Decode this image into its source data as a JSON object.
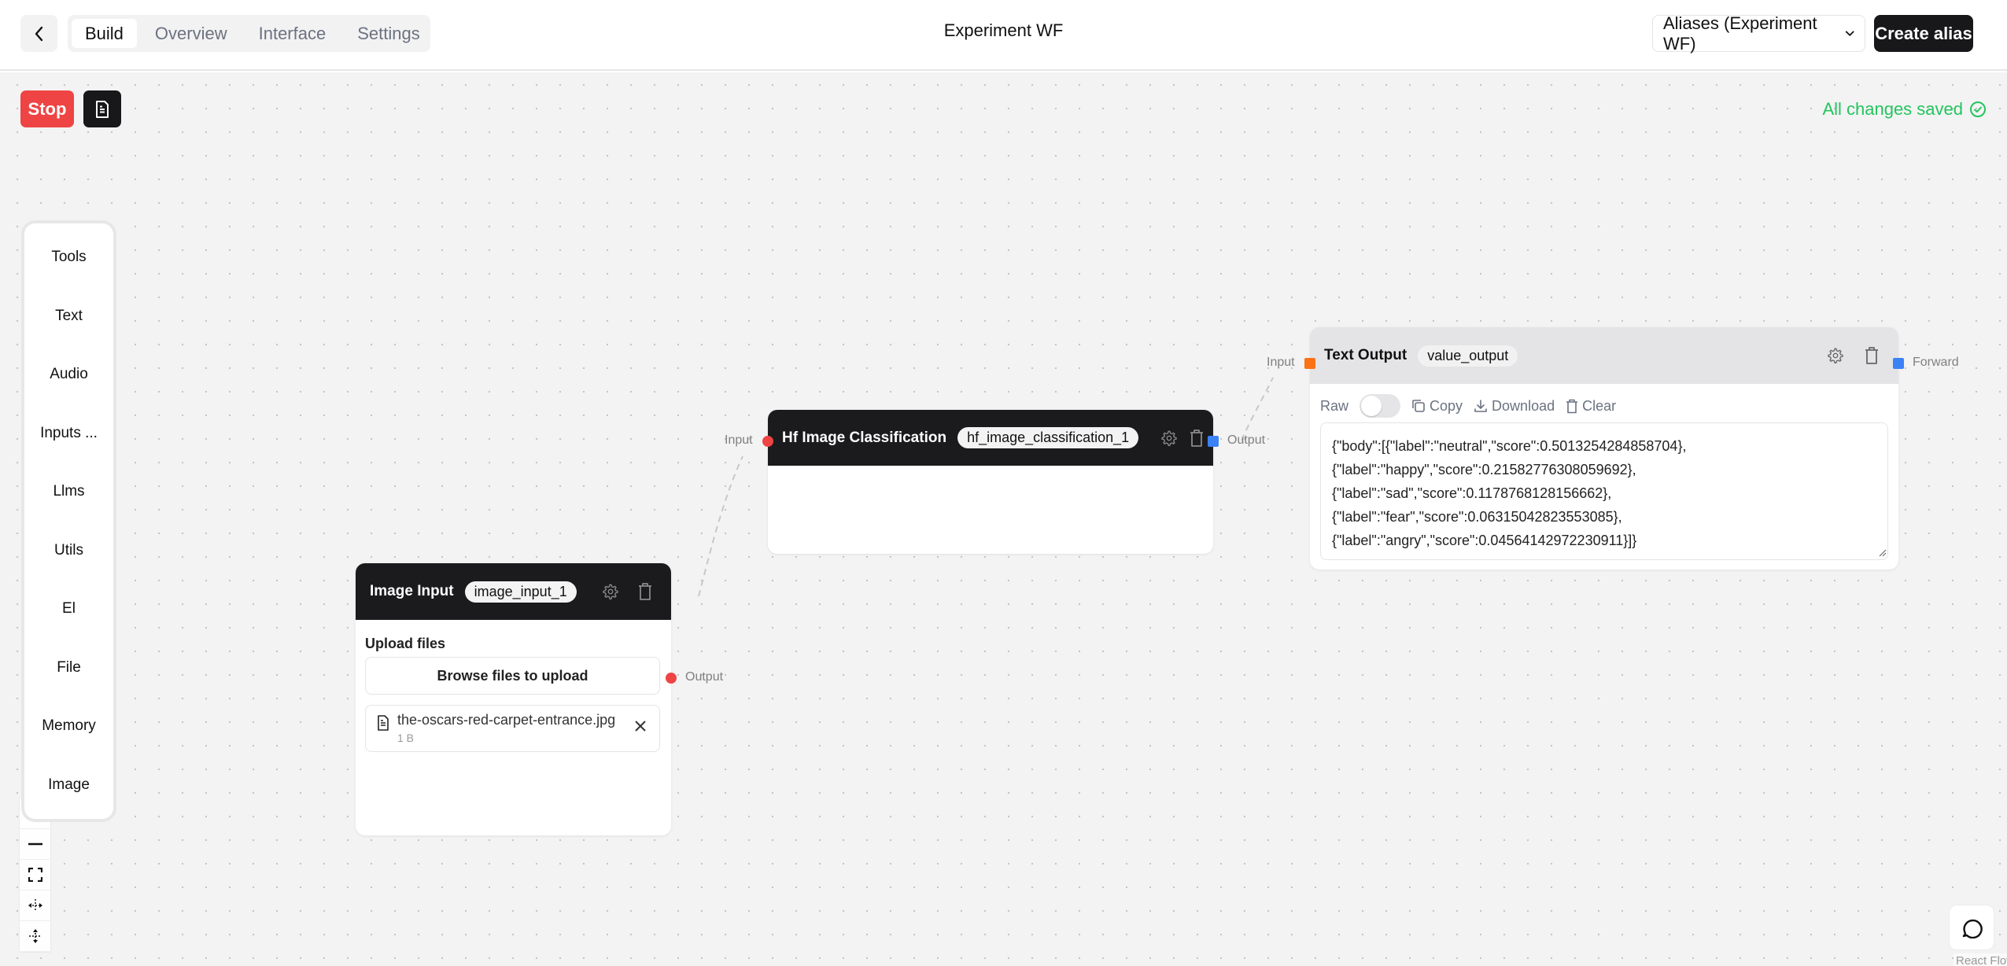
{
  "header": {
    "back_label": "Back",
    "tabs": [
      {
        "label": "Build",
        "active": true
      },
      {
        "label": "Overview",
        "active": false
      },
      {
        "label": "Interface",
        "active": false
      },
      {
        "label": "Settings",
        "active": false
      }
    ],
    "title": "Experiment WF",
    "alias_select": {
      "selected": "Aliases (Experiment WF)",
      "icon": "chevron-down-icon"
    },
    "create_alias_label": "Create alias"
  },
  "toolbar": {
    "stop_label": "Stop",
    "doc_icon": "file-text-icon",
    "save_status": "All changes saved",
    "save_status_icon": "check-circle-icon"
  },
  "sidebar": {
    "items": [
      {
        "label": "Tools"
      },
      {
        "label": "Text"
      },
      {
        "label": "Audio"
      },
      {
        "label": "Inputs ..."
      },
      {
        "label": "Llms"
      },
      {
        "label": "Utils"
      },
      {
        "label": "El"
      },
      {
        "label": "File"
      },
      {
        "label": "Memory"
      },
      {
        "label": "Image"
      }
    ]
  },
  "controls": [
    {
      "name": "zoom-out",
      "icon": "minus-icon"
    },
    {
      "name": "fit-view",
      "icon": "fullscreen-icon"
    },
    {
      "name": "move-horizontal",
      "icon": "move-horizontal-icon"
    },
    {
      "name": "move-vertical",
      "icon": "move-vertical-icon"
    }
  ],
  "nodes": {
    "image_input": {
      "title": "Image Input",
      "id_chip": "image_input_1",
      "output_label": "Output",
      "upload_label": "Upload files",
      "browse_label": "Browse files to upload",
      "file": {
        "name": "the-oscars-red-carpet-entrance.jpg",
        "size": "1 B"
      }
    },
    "hf_image_classification": {
      "title": "Hf Image Classification",
      "id_chip": "hf_image_classification_1",
      "input_label": "Input",
      "output_label": "Output"
    },
    "text_output": {
      "title": "Text Output",
      "id_chip": "value_output",
      "input_label": "Input",
      "forward_label": "Forward",
      "raw_label": "Raw",
      "raw_enabled": false,
      "copy_label": "Copy",
      "download_label": "Download",
      "clear_label": "Clear",
      "value": "{\"body\":[{\"label\":\"neutral\",\"score\":0.5013254284858704},\n{\"label\":\"happy\",\"score\":0.21582776308059692},\n{\"label\":\"sad\",\"score\":0.1178768128156662},\n{\"label\":\"fear\",\"score\":0.06315042823553085},\n{\"label\":\"angry\",\"score\":0.04564142972230911}]}"
    }
  },
  "colors": {
    "stop": "#ef4444",
    "saved": "#22c55e",
    "handle_red": "#ef4444",
    "handle_blue": "#3b82f6",
    "handle_orange": "#f97316",
    "node_header_dark": "#1b1b1d"
  },
  "chat_icon": "message-circle-icon",
  "attribution": "React Flow"
}
